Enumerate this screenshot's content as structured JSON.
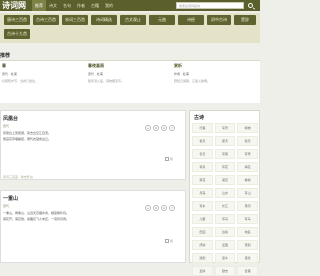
{
  "header": {
    "logo": "诗词网",
    "nav": [
      "推荐",
      "诗文",
      "名句",
      "作者",
      "古籍",
      "我的"
    ],
    "search_placeholder": "搜索古诗词名句"
  },
  "chips": [
    [
      "唐诗三百首",
      "古诗三百首",
      "宋词三百首",
      "诗词精选"
    ],
    [
      "古文观止",
      "元曲",
      "诗经",
      "初中古诗",
      "小学古诗",
      "楚辞"
    ],
    [
      "古诗十九首"
    ]
  ],
  "recommend": {
    "title": "推荐",
    "cols": [
      {
        "title": "春",
        "author": "唐代 · 杜甫",
        "line": "好雨知时节，当春乃发生。"
      },
      {
        "title": "春夜喜雨",
        "author": "唐代 · 杜甫",
        "line": "随风潜入夜，润物细无声。"
      },
      {
        "title": "赏析",
        "author": "作者 · 杜甫",
        "line": "野径云俱黑，江船火独明。"
      }
    ]
  },
  "poems": [
    {
      "title": "凤凰台",
      "author": "唐代",
      "lines": [
        "凤凰台上凤凰游，凤去台空江自流。",
        "吴宫花草埋幽径，晋代衣冠成古丘。"
      ],
      "tags": "唐诗三百首 · 咏史怀古",
      "likes": "赞"
    },
    {
      "title": "一重山",
      "author": "唐代",
      "lines": [
        "一重山，两重山，山远天高烟水寒，相思枫叶丹。",
        "菊花开，菊花残，塞雁高飞人未还，一帘风月闲。"
      ],
      "tags": "",
      "likes": "赞"
    }
  ],
  "sidebar": {
    "title": "古诗",
    "items": [
      "行路",
      "写景",
      "咏物",
      "春天",
      "夏天",
      "秋天",
      "冬天",
      "写雨",
      "写雪",
      "写风",
      "写花",
      "梅花",
      "荷花",
      "菊花",
      "柳树",
      "月亮",
      "山水",
      "写山",
      "写水",
      "长江",
      "黄河",
      "儿童",
      "写鸟",
      "写马",
      "田园",
      "边塞",
      "地名",
      "抒情",
      "爱国",
      "离别",
      "送别",
      "思乡",
      "思念",
      "爱情",
      "励志",
      "哲理"
    ]
  },
  "colors": {
    "topbar": "#5a5f2c",
    "chip": "#5f632f"
  }
}
